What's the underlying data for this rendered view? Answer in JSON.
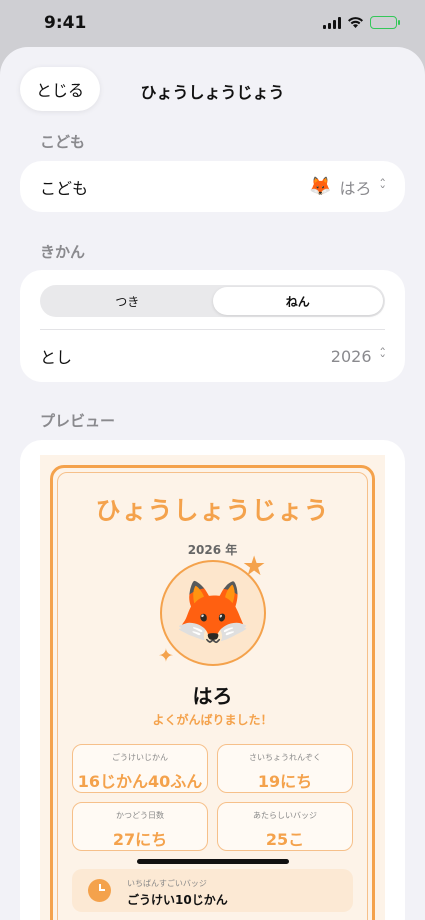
{
  "status_bar": {
    "time": "9:41"
  },
  "sheet": {
    "close_label": "とじる",
    "title": "ひょうしょうじょう"
  },
  "child_section": {
    "header": "こども",
    "row_label": "こども",
    "avatar_emoji": "🦊",
    "selected_name": "はろ"
  },
  "period_section": {
    "header": "きかん",
    "segments": [
      "つき",
      "ねん"
    ],
    "selected_segment": "ねん",
    "year_label": "とし",
    "year_value": "2026"
  },
  "preview_section": {
    "header": "プレビュー"
  },
  "certificate": {
    "title": "ひょうしょうじょう",
    "year": "2026 年",
    "avatar_emoji": "🦊",
    "name": "はろ",
    "message": "よくがんばりました！",
    "stats": [
      {
        "label": "ごうけいじかん",
        "value": "16じかん40ふん"
      },
      {
        "label": "さいちょうれんぞく",
        "value": "19にち"
      },
      {
        "label": "かつどう日数",
        "value": "27にち"
      },
      {
        "label": "あたらしいバッジ",
        "value": "25こ"
      }
    ],
    "best_badge": {
      "label": "いちばんすごいバッジ",
      "value": "ごうけい10じかん"
    }
  },
  "colors": {
    "accent": "#f4a24c",
    "battery": "#34c759",
    "background": "#f2f2f7"
  }
}
